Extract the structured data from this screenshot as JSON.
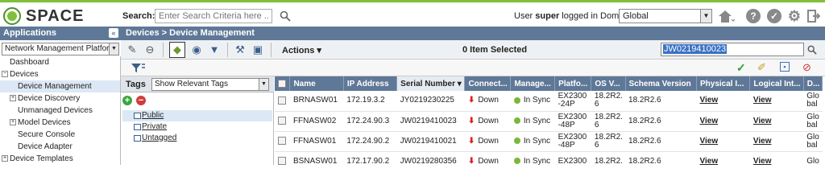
{
  "app": {
    "logo_text": "SPACE"
  },
  "search": {
    "label": "Search:",
    "placeholder": "Enter Search Criteria here ..."
  },
  "user": {
    "text_prefix": "User ",
    "username": "super",
    "text_suffix": " logged in Domain:"
  },
  "domain": {
    "selected": "Global"
  },
  "applications": {
    "title": "Applications",
    "platform_selected": "Network Management Platform"
  },
  "nav": [
    {
      "label": "Dashboard",
      "indent": 1,
      "expander": "",
      "active": false
    },
    {
      "label": "Devices",
      "indent": 0,
      "expander": "−",
      "active": false
    },
    {
      "label": "Device Management",
      "indent": 2,
      "expander": "",
      "active": true
    },
    {
      "label": "Device Discovery",
      "indent": 1,
      "expander": "+",
      "active": false
    },
    {
      "label": "Unmanaged Devices",
      "indent": 2,
      "expander": "",
      "active": false
    },
    {
      "label": "Model Devices",
      "indent": 1,
      "expander": "+",
      "active": false
    },
    {
      "label": "Secure Console",
      "indent": 2,
      "expander": "",
      "active": false
    },
    {
      "label": "Device Adapter",
      "indent": 2,
      "expander": "",
      "active": false
    },
    {
      "label": "Device Templates",
      "indent": 0,
      "expander": "+",
      "active": false
    }
  ],
  "breadcrumb": {
    "text": "Devices  >  Device Management"
  },
  "toolbar": {
    "actions_label": "Actions ▾",
    "selected_text": "0 Item Selected",
    "filter_value": "JW0219410023"
  },
  "tags": {
    "title": "Tags",
    "select_value": "Show Relevant Tags",
    "items": [
      "Public",
      "Private",
      "Untagged"
    ]
  },
  "table": {
    "columns": [
      "Name",
      "IP Address",
      "Serial Number ▾",
      "Connect...",
      "Manage...",
      "Platfo...",
      "OS V...",
      "Schema Version",
      "Physical I...",
      "Logical Int...",
      "D..."
    ],
    "rows": [
      {
        "name": "BRNASW01",
        "ip": "172.19.3.2",
        "serial": "JY0219230225",
        "conn": "Down",
        "manage": "In Sync",
        "platform": "EX2300 -24P",
        "os": "18.2R2. 6",
        "schema": "18.2R2.6",
        "physical": "View",
        "logical": "View",
        "d": "Glo bal"
      },
      {
        "name": "FFNASW02",
        "ip": "172.24.90.3",
        "serial": "JW0219410023",
        "conn": "Down",
        "manage": "In Sync",
        "platform": "EX2300 -48P",
        "os": "18.2R2. 6",
        "schema": "18.2R2.6",
        "physical": "View",
        "logical": "View",
        "d": "Glo bal"
      },
      {
        "name": "FFNASW01",
        "ip": "172.24.90.2",
        "serial": "JW0219410021",
        "conn": "Down",
        "manage": "In Sync",
        "platform": "EX2300 -48P",
        "os": "18.2R2. 6",
        "schema": "18.2R2.6",
        "physical": "View",
        "logical": "View",
        "d": "Glo bal"
      },
      {
        "name": "BSNASW01",
        "ip": "172.17.90.2",
        "serial": "JW0219280356",
        "conn": "Down",
        "manage": "In Sync",
        "platform": "EX2300",
        "os": "18.2R2.",
        "schema": "18.2R2.6",
        "physical": "View",
        "logical": "View",
        "d": "Glo"
      }
    ]
  },
  "colors": {
    "accent": "#7fbf3a",
    "header": "#5f7897",
    "down": "#dd2222",
    "in_sync": "#79b93a"
  }
}
